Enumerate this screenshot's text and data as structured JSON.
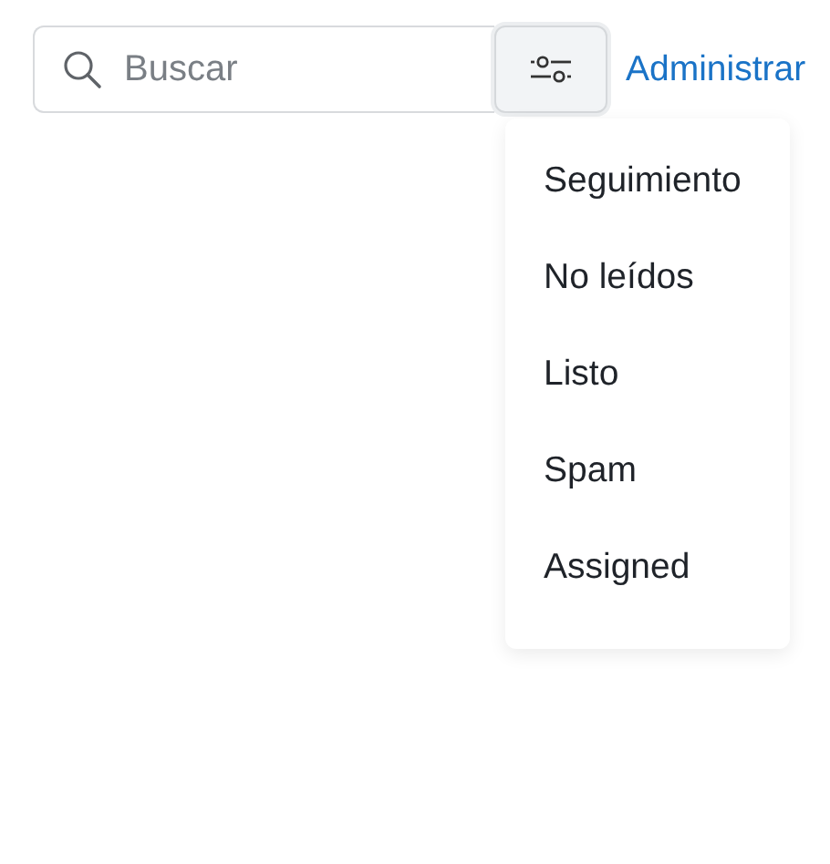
{
  "search": {
    "placeholder": "Buscar"
  },
  "manage_link": "Administrar",
  "filter_menu": {
    "items": [
      "Seguimiento",
      "No leídos",
      "Listo",
      "Spam",
      "Assigned"
    ]
  }
}
